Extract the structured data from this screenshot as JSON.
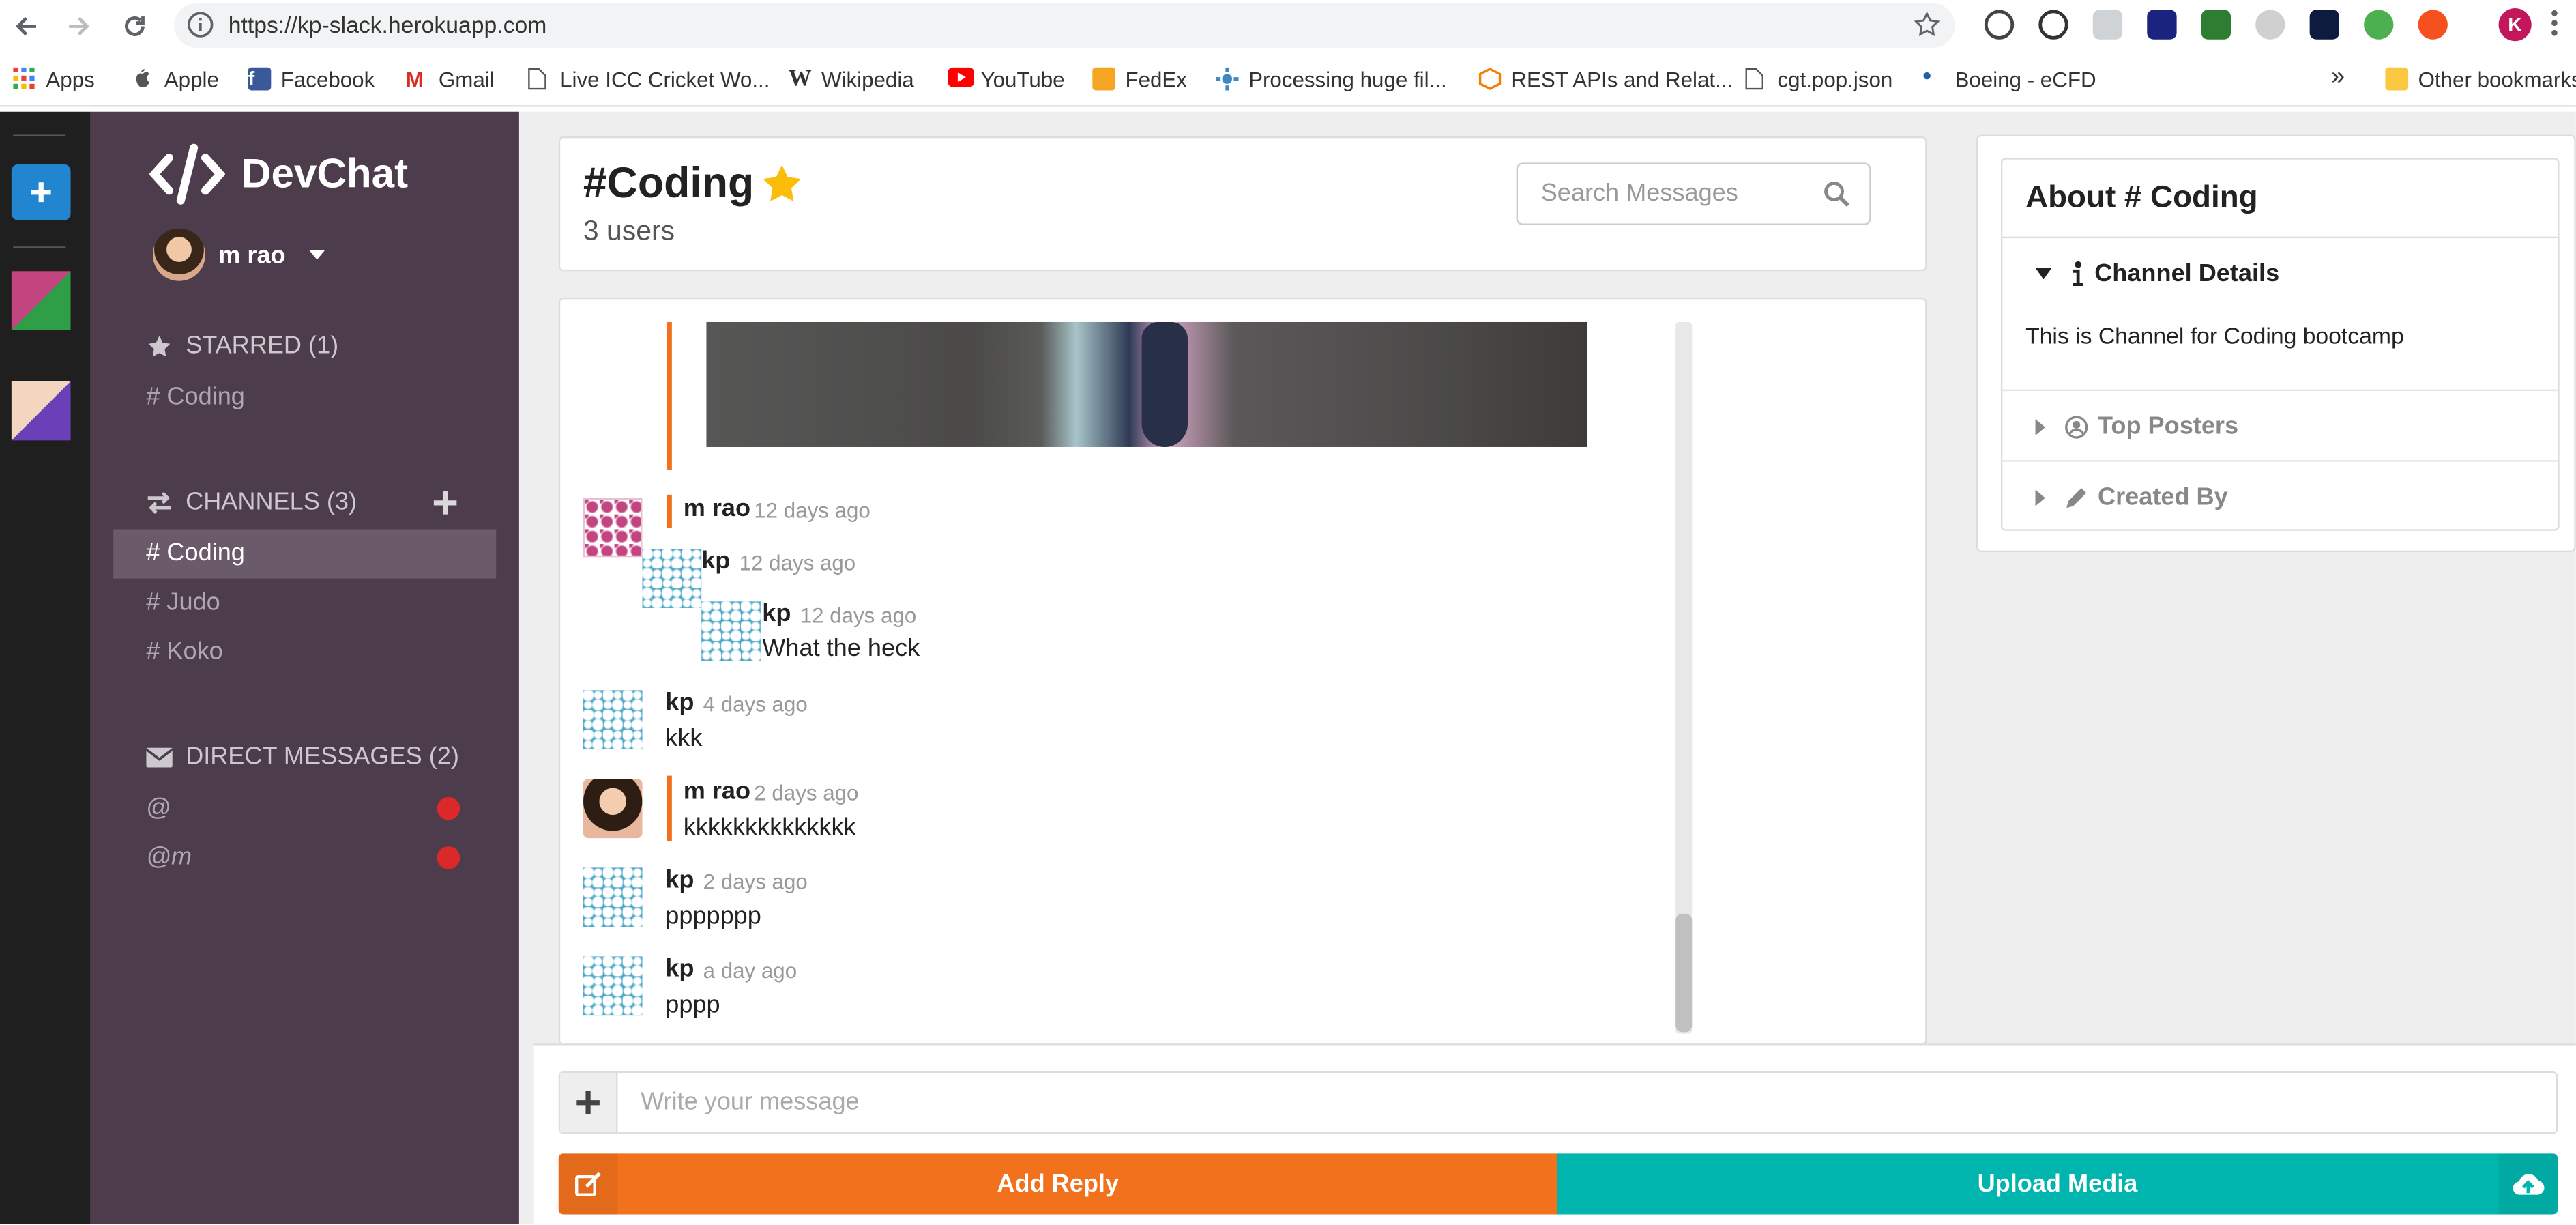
{
  "browser": {
    "url": "https://kp-slack.herokuapp.com",
    "profile_initial": "K",
    "bookmarks": [
      {
        "label": "Apps",
        "icon": "apps-grid-icon"
      },
      {
        "label": "Apple",
        "icon": "apple-icon"
      },
      {
        "label": "Facebook",
        "icon": "facebook-icon"
      },
      {
        "label": "Gmail",
        "icon": "gmail-icon"
      },
      {
        "label": "Live ICC Cricket Wo...",
        "icon": "page-icon"
      },
      {
        "label": "Wikipedia",
        "icon": "wikipedia-icon"
      },
      {
        "label": "YouTube",
        "icon": "youtube-icon"
      },
      {
        "label": "FedEx",
        "icon": "fedex-icon"
      },
      {
        "label": "Processing huge fil...",
        "icon": "processing-icon"
      },
      {
        "label": "REST APIs and Relat...",
        "icon": "box-icon"
      },
      {
        "label": "cgt.pop.json",
        "icon": "page-icon"
      },
      {
        "label": "Boeing - eCFD",
        "icon": "boeing-icon"
      }
    ],
    "more_bookmarks": "»",
    "other_bookmarks": "Other bookmarks"
  },
  "app": {
    "name": "DevChat",
    "user": {
      "name": "m rao"
    },
    "starred": {
      "title": "STARRED (1)",
      "items": [
        "# Coding"
      ]
    },
    "channels": {
      "title": "CHANNELS (3)",
      "items": [
        "# Coding",
        "# Judo",
        "# Koko"
      ],
      "active_index": 0
    },
    "direct_messages": {
      "title": "DIRECT MESSAGES (2)",
      "items": [
        "@",
        "@m"
      ]
    }
  },
  "channel": {
    "title": "#Coding",
    "users": "3 users",
    "search_placeholder": "Search Messages"
  },
  "messages": [
    {
      "author": "m rao",
      "time": "12 days ago",
      "text": ""
    },
    {
      "author": "kp",
      "time": "12 days ago",
      "text": ""
    },
    {
      "author": "kp",
      "time": "12 days ago",
      "text": "What the heck"
    },
    {
      "author": "kp",
      "time": "4 days ago",
      "text": "kkk"
    },
    {
      "author": "m rao",
      "time": "2 days ago",
      "text": "kkkkkkkkkkkkkk"
    },
    {
      "author": "kp",
      "time": "2 days ago",
      "text": "ppppppp"
    },
    {
      "author": "kp",
      "time": "a day ago",
      "text": "pppp"
    }
  ],
  "compose": {
    "placeholder": "Write your message",
    "reply_label": "Add Reply",
    "upload_label": "Upload Media"
  },
  "about": {
    "title": "About # Coding",
    "channel_details_label": "Channel Details",
    "channel_details_text": "This is Channel for Coding bootcamp",
    "top_posters_label": "Top Posters",
    "created_by_label": "Created By"
  },
  "colors": {
    "sidebar": "#4c3c4c",
    "strip": "#1f1f1f",
    "accent_orange": "#f2711c",
    "accent_teal": "#00b5ad",
    "star_yellow": "#fbbd08",
    "dm_dot_red": "#db2828",
    "add_team_blue": "#2185d0"
  }
}
